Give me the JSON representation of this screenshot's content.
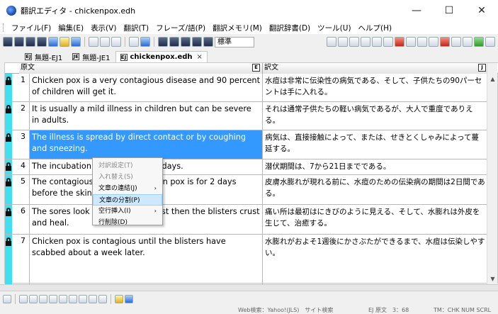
{
  "window": {
    "title": "翻訳エディタ - chickenpox.edh",
    "controls": [
      "—",
      "☐",
      "✕"
    ]
  },
  "menu": [
    "ファイル(F)",
    "編集(E)",
    "表示(V)",
    "翻訳(T)",
    "フレーズ/語(P)",
    "翻訳メモリ(M)",
    "翻訳辞書(D)",
    "ツール(U)",
    "ヘルプ(H)"
  ],
  "toolbar": {
    "style_combo": "標準"
  },
  "tabs": [
    {
      "label": "無題-EJ1",
      "icon": "EJ",
      "active": false
    },
    {
      "label": "無題-JE1",
      "icon": "JE",
      "active": false
    },
    {
      "label": "chickenpox.edh",
      "icon": "EJ",
      "active": true,
      "close": "×"
    }
  ],
  "grid": {
    "source_header": "原文",
    "target_header": "訳文",
    "rows": [
      {
        "num": "1",
        "src": "Chicken pox is a very contagious disease and 90 percent of children will get it.",
        "tgt": "水痘は非常に伝染性の病気である、そして、子供たちの90パーセントは手に入れる。"
      },
      {
        "num": "2",
        "src": "It is usually a mild illness in children but can be severe in adults.",
        "tgt": "それは通常子供たちの軽い病気であるが、大人で重度でありえる。"
      },
      {
        "num": "3",
        "src": "The illness is spread by direct contact or by coughing and sneezing.",
        "tgt": "病気は、直接接触によって、または、せきとくしゃみによって蔓延する。",
        "selected": true
      },
      {
        "num": "4",
        "src": "The incubation period is 7 to 21 days.",
        "tgt": "潜伏期間は、7から21日までである。"
      },
      {
        "num": "5",
        "src": "The contagious period for chicken pox is for 2 days before the skin blisters appear.",
        "tgt": "皮膚水膨れが現れる前に、水痘のための伝染病の期間は2日間である。"
      },
      {
        "num": "6",
        "src": "The sores look like pimples at first then the blisters crust and heal.",
        "tgt": "痛い所は最初はにきびのように見える、そして、水膨れは外皮を生じて、治癒する。"
      },
      {
        "num": "7",
        "src": "Chicken pox is contagious until the blisters have scabbed about a week later.",
        "tgt": "水膨れがおよそ1週後にかさぶたができるまで、水痘は伝染しやすい。"
      }
    ]
  },
  "context_menu": {
    "items": [
      {
        "label": "対訳設定(T)",
        "disabled": true
      },
      {
        "label": "入れ替え(S)",
        "disabled": true
      },
      {
        "label": "文章の連結(J)",
        "submenu": true
      },
      {
        "label": "文章の分割(P)",
        "highlighted": true
      },
      {
        "label": "空行挿入(I)",
        "submenu": true
      },
      {
        "label": "行削除(D)"
      }
    ],
    "submenu_arrow": "›"
  },
  "status": {
    "web_search": "Web検索：Yahoo!(JLS)　サイト検索",
    "position": "EJ 原文　3：68",
    "mode": "TM：CHK NUM SCRL"
  }
}
